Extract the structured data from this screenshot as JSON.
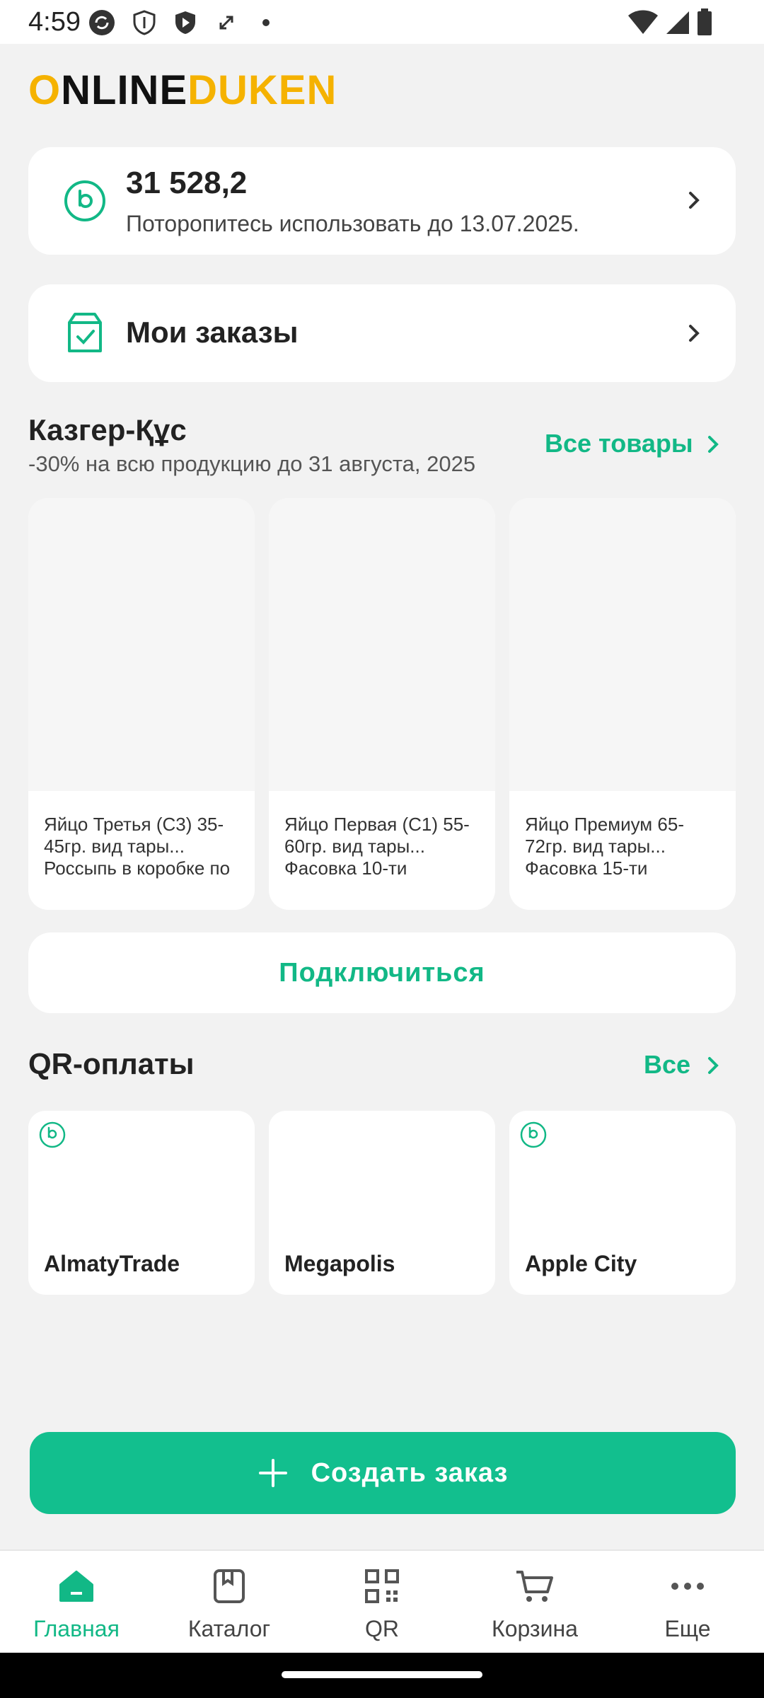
{
  "status_bar": {
    "time": "4:59"
  },
  "logo": {
    "part1": "O",
    "part2": "NLINE",
    "part3": "DUKEN"
  },
  "bonus": {
    "amount": "31 528,2",
    "subtitle": "Поторопитесь использовать до 13.07.2025."
  },
  "orders": {
    "label": "Мои заказы"
  },
  "promo": {
    "title": "Казгер-Құс",
    "subtitle": "-30% на всю продукцию до 31 августа, 2025",
    "link": "Все товары",
    "products": [
      {
        "name": "Яйцо Третья (С3) 35-45гр. вид тары... Россыпь в коробке по"
      },
      {
        "name": "Яйцо Первая (С1) 55-60гр. вид тары... Фасовка 10-ти"
      },
      {
        "name": "Яйцо Премиум 65-72гр. вид тары... Фасовка 15-ти"
      }
    ]
  },
  "connect_button": "Подключиться",
  "qr": {
    "title": "QR-оплаты",
    "link": "Все",
    "merchants": [
      {
        "name": "AlmatyTrade"
      },
      {
        "name": "Megapolis"
      },
      {
        "name": "Apple City"
      }
    ]
  },
  "create_order": "Создать заказ",
  "nav": [
    {
      "label": "Главная",
      "icon": "home-icon"
    },
    {
      "label": "Каталог",
      "icon": "catalog-icon"
    },
    {
      "label": "QR",
      "icon": "qr-icon"
    },
    {
      "label": "Корзина",
      "icon": "cart-icon"
    },
    {
      "label": "Еще",
      "icon": "more-icon"
    }
  ],
  "colors": {
    "accent": "#12b886",
    "logo_yellow": "#f5b200",
    "button": "#12bf8e"
  }
}
